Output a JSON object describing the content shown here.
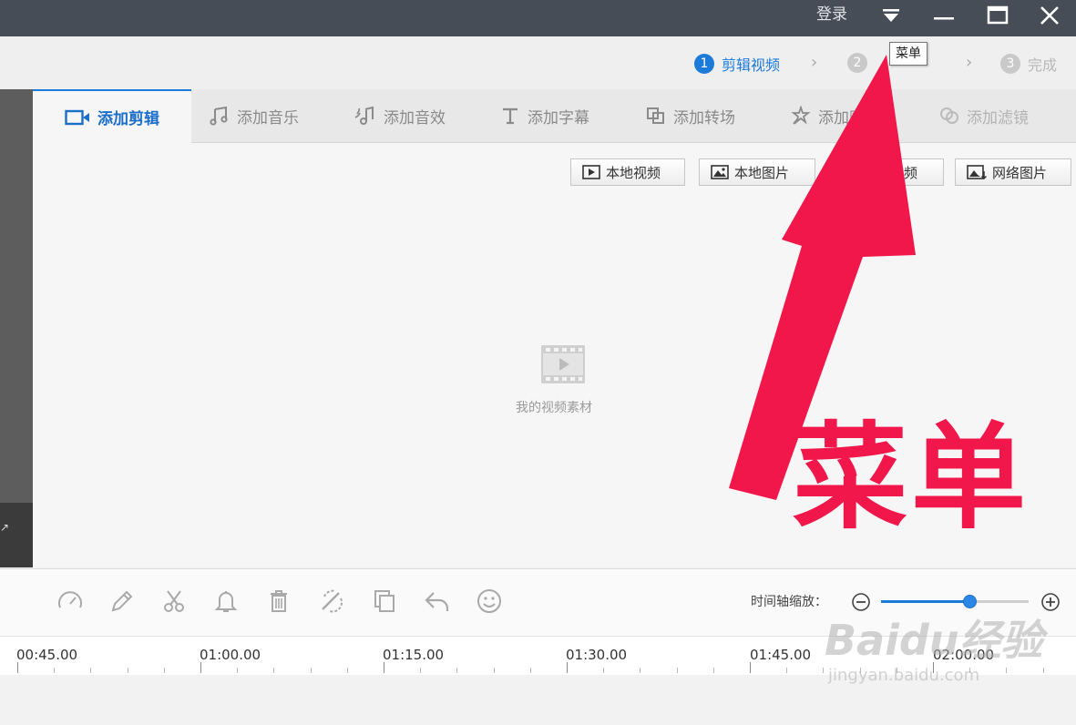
{
  "titlebar": {
    "login": "登录"
  },
  "steps": [
    {
      "num": "1",
      "label": "剪辑视频"
    },
    {
      "num": "2",
      "label": ""
    },
    {
      "num": "3",
      "label": "完成"
    }
  ],
  "tooltip": "菜单",
  "tabs": [
    {
      "label": "添加剪辑",
      "icon": "video-camera-icon"
    },
    {
      "label": "添加音乐",
      "icon": "music-note-icon"
    },
    {
      "label": "添加音效",
      "icon": "sound-effect-icon"
    },
    {
      "label": "添加字幕",
      "icon": "text-t-icon"
    },
    {
      "label": "添加转场",
      "icon": "transition-icon"
    },
    {
      "label": "添加贴图",
      "icon": "sticker-icon"
    },
    {
      "label": "添加滤镜",
      "icon": "filter-icon"
    }
  ],
  "source_buttons": [
    {
      "label": "本地视频",
      "icon": "video-file-icon"
    },
    {
      "label": "本地图片",
      "icon": "image-file-icon"
    },
    {
      "label": "网络视频",
      "icon": "network-video-icon"
    },
    {
      "label": "网络图片",
      "icon": "network-image-icon"
    }
  ],
  "empty_state": {
    "text": "我的视频素材"
  },
  "toolbar": {
    "tools": [
      "speed-icon",
      "pencil-icon",
      "scissors-icon",
      "bell-icon",
      "trash-icon",
      "magic-icon",
      "copy-icon",
      "undo-icon",
      "emoji-icon"
    ],
    "zoom_label": "时间轴缩放：",
    "zoom_level": 0.6
  },
  "timeline": {
    "labels": [
      "00:45.00",
      "01:00.00",
      "01:15.00",
      "01:30.00",
      "01:45.00",
      "02:00.00"
    ]
  },
  "annotation": {
    "text": "菜单",
    "color": "#f1174b"
  },
  "watermark": {
    "line1": "Baidu经验",
    "line2": "jingyan.baidu.com"
  },
  "colors": {
    "accent": "#1c7ad9",
    "titlebar": "#474d57"
  }
}
